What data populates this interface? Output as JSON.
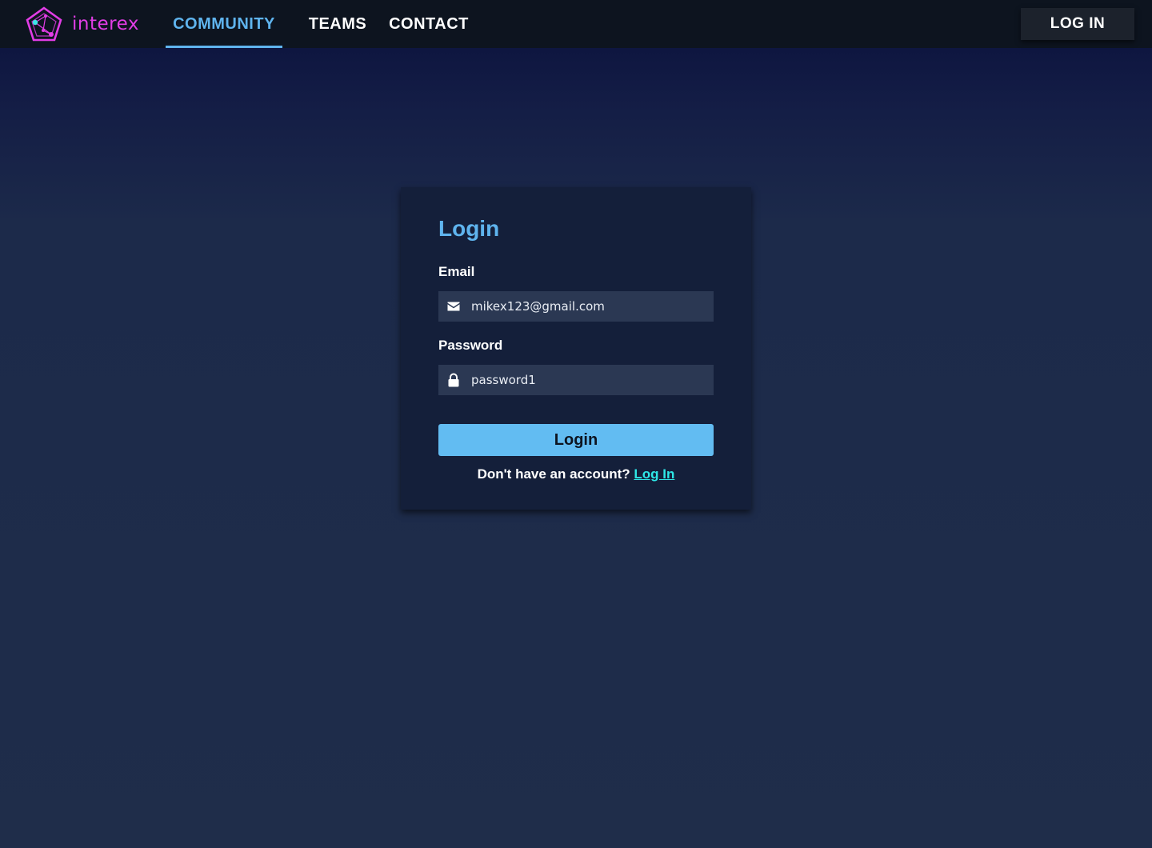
{
  "header": {
    "brand_name": "interex",
    "brand_color": "#e23de6",
    "logo_icon": "pentagon-network-logo",
    "nav": [
      {
        "label": "COMMUNITY",
        "active": true
      },
      {
        "label": "TEAMS",
        "active": false
      },
      {
        "label": "CONTACT",
        "active": false
      }
    ],
    "login_button": "LOG IN"
  },
  "login_form": {
    "title": "Login",
    "email_label": "Email",
    "email_value": "mikex123@gmail.com",
    "email_icon": "envelope-icon",
    "password_label": "Password",
    "password_value": "password1",
    "password_icon": "lock-icon",
    "submit_label": "Login",
    "signup_prompt": "Don't have an account?",
    "signup_link": "Log In"
  },
  "colors": {
    "accent": "#5fb4ee",
    "button": "#62bcf2",
    "link": "#2ee6e6",
    "navbar": "#0d141f",
    "card": "#141f3a",
    "input": "#2b3853"
  }
}
